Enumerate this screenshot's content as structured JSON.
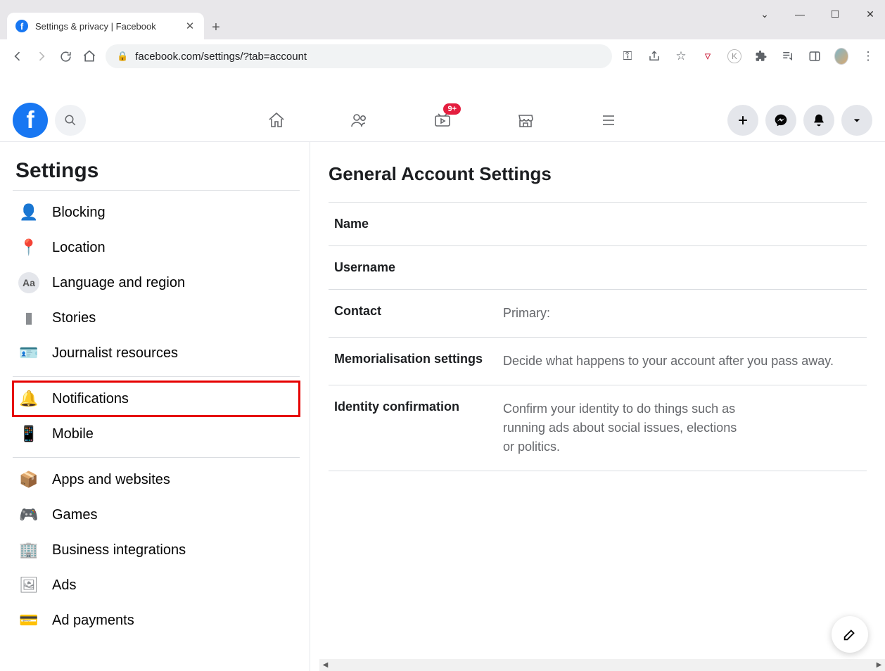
{
  "browser": {
    "tab_title": "Settings & privacy | Facebook",
    "url": "facebook.com/settings/?tab=account"
  },
  "fb_header": {
    "watch_badge": "9+"
  },
  "sidebar": {
    "title": "Settings",
    "groups": [
      {
        "items": [
          {
            "id": "blocking",
            "label": "Blocking",
            "icon": "👤"
          },
          {
            "id": "location",
            "label": "Location",
            "icon": "📍"
          },
          {
            "id": "language",
            "label": "Language and region",
            "icon": "Aa"
          },
          {
            "id": "stories",
            "label": "Stories",
            "icon": "▮"
          },
          {
            "id": "journalist",
            "label": "Journalist resources",
            "icon": "🪪"
          }
        ]
      },
      {
        "items": [
          {
            "id": "notifications",
            "label": "Notifications",
            "icon": "🔔",
            "highlight": true
          },
          {
            "id": "mobile",
            "label": "Mobile",
            "icon": "📱"
          }
        ]
      },
      {
        "items": [
          {
            "id": "apps",
            "label": "Apps and websites",
            "icon": "📦"
          },
          {
            "id": "games",
            "label": "Games",
            "icon": "🎮"
          },
          {
            "id": "business",
            "label": "Business integrations",
            "icon": "🏢"
          },
          {
            "id": "ads",
            "label": "Ads",
            "icon": "🖼"
          },
          {
            "id": "adpayments",
            "label": "Ad payments",
            "icon": "💳"
          }
        ]
      }
    ]
  },
  "main": {
    "title": "General Account Settings",
    "rows": [
      {
        "label": "Name",
        "value": ""
      },
      {
        "label": "Username",
        "value": ""
      },
      {
        "label": "Contact",
        "value": "Primary:"
      },
      {
        "label": "Memorialisation settings",
        "value": "Decide what happens to your account after you pass away."
      },
      {
        "label": "Identity confirmation",
        "value": "Confirm your identity to do things such as running ads about social issues, elections or politics."
      }
    ]
  }
}
